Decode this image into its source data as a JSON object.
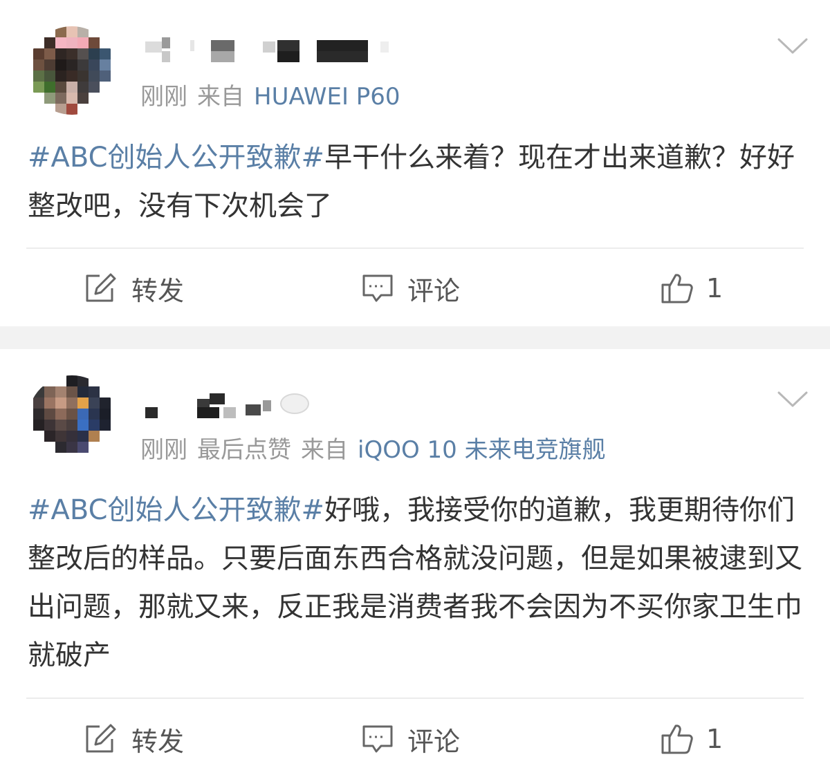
{
  "posts": [
    {
      "time": "刚刚",
      "extra": "",
      "source_prefix": "来自",
      "device": "HUAWEI P60",
      "topic": "#ABC创始人公开致歉#",
      "text": "早干什么来着？现在才出来道歉？好好整改吧，没有下次机会了",
      "actions": {
        "repost_label": "转发",
        "comment_label": "评论",
        "like_count": "1"
      }
    },
    {
      "time": "刚刚",
      "extra": "最后点赞",
      "source_prefix": "来自",
      "device": "iQOO 10 未来电竞旗舰",
      "topic": "#ABC创始人公开致歉#",
      "text": "好哦，我接受你的道歉，我更期待你们整改后的样品。只要后面东西合格就没问题，但是如果被逮到又出问题，那就又来，反正我是消费者我不会因为不买你家卫生巾就破产",
      "actions": {
        "repost_label": "转发",
        "comment_label": "评论",
        "like_count": "1"
      }
    }
  ],
  "icons": {
    "repost": "edit-share-icon",
    "comment": "comment-bubble-icon",
    "like": "thumbs-up-icon",
    "menu": "chevron-down-icon"
  },
  "colors": {
    "topic_link": "#5a7fa6",
    "meta_gray": "#999999",
    "body_text": "#333333",
    "background": "#f2f2f2"
  }
}
